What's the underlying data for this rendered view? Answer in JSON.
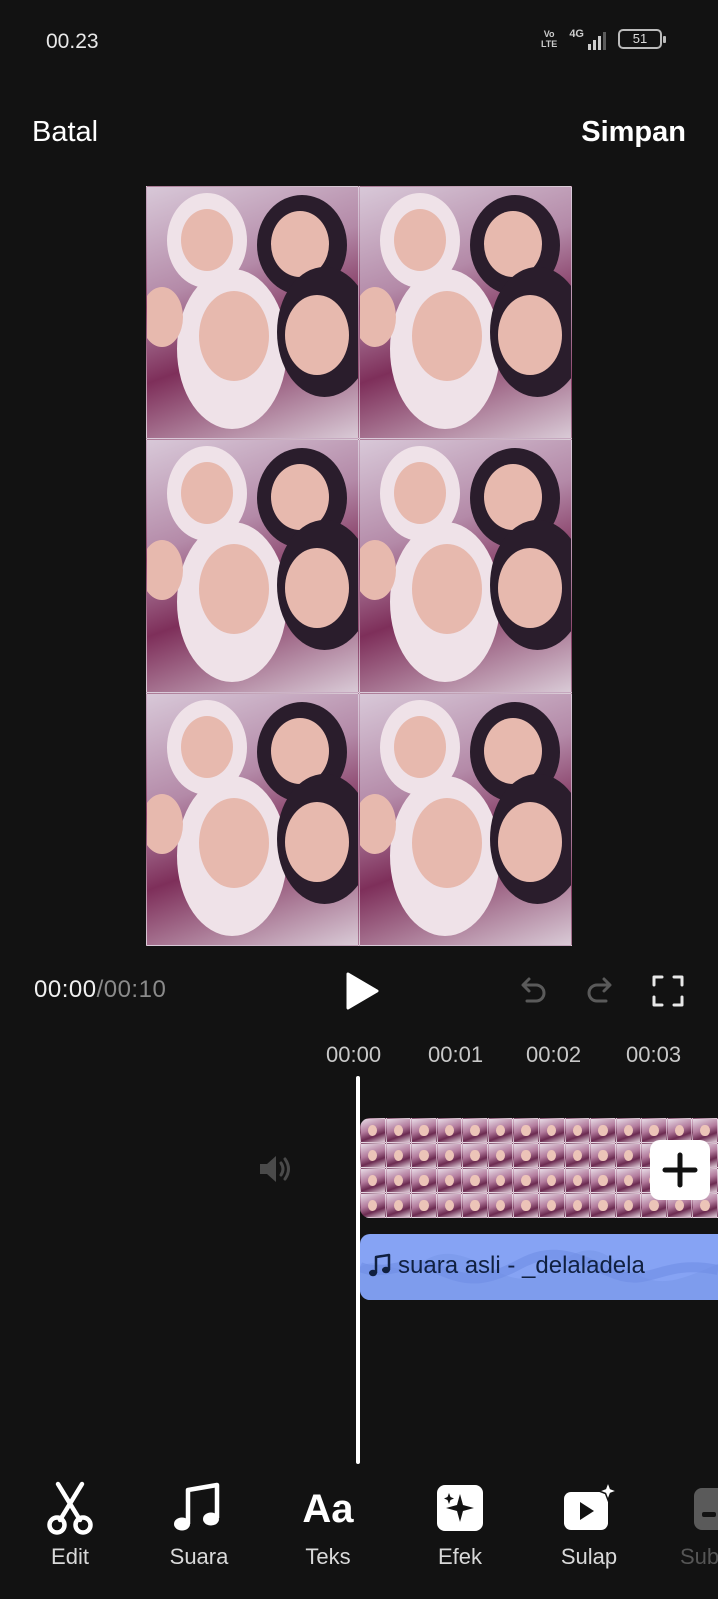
{
  "status_bar": {
    "time": "00.23",
    "volte": [
      "Vo",
      "LTE"
    ],
    "network": "4G",
    "battery": "51"
  },
  "header": {
    "cancel_label": "Batal",
    "save_label": "Simpan"
  },
  "playback": {
    "current_time": "00:00",
    "total_time": "/00:10"
  },
  "ruler": {
    "labels": [
      "00:00",
      "00:01",
      "00:02",
      "00:03"
    ]
  },
  "audio_track": {
    "label": "suara asli - _delaladela"
  },
  "toolbar": {
    "items": [
      {
        "label": "Edit",
        "icon": "scissors-icon"
      },
      {
        "label": "Suara",
        "icon": "music-note-icon"
      },
      {
        "label": "Teks",
        "icon": "text-icon"
      },
      {
        "label": "Efek",
        "icon": "sparkle-icon"
      },
      {
        "label": "Sulap",
        "icon": "magic-video-icon"
      },
      {
        "label": "Sub",
        "icon": "subtitle-icon"
      }
    ]
  },
  "colors": {
    "background": "#121212",
    "audio_track": "#86a3f4",
    "accent_text": "#ffffff"
  }
}
